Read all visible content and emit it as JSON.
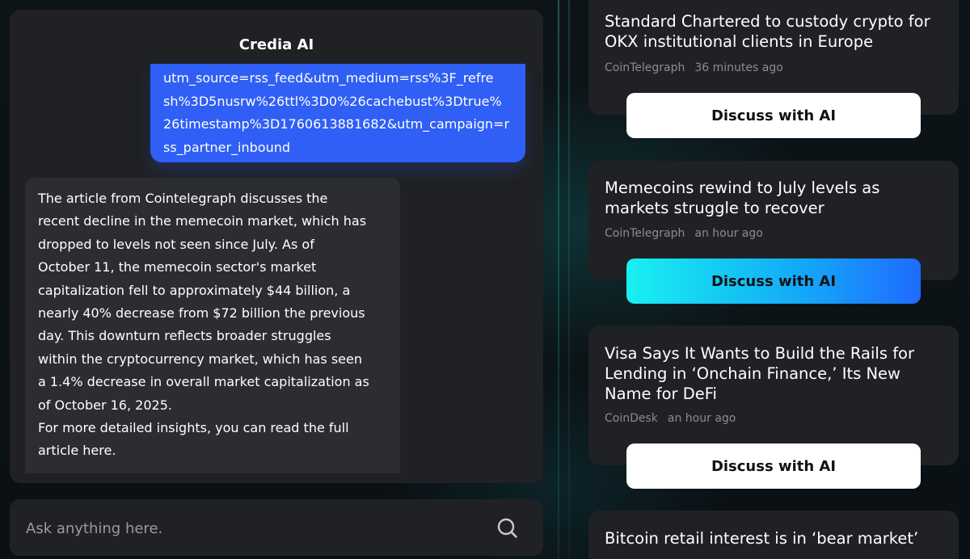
{
  "chat": {
    "title": "Credia AI",
    "user_message_lines": [
      "utm_source=rss_feed&utm_medium=rss%3F_refre",
      "sh%3D5nusrw%26ttl%3D0%26cachebust%3Dtrue%",
      "26timestamp%3D1760613881682&utm_campaign=r",
      "ss_partner_inbound"
    ],
    "ai_message_lines": [
      "The article from Cointelegraph discusses the",
      "recent decline in the memecoin market, which has",
      "dropped to levels not seen since July. As of",
      "October 11, the memecoin sector's market",
      "capitalization fell to approximately $44 billion, a",
      "nearly 40% decrease from $72 billion the previous",
      "day. This downturn reflects broader struggles",
      "within the cryptocurrency market, which has seen",
      "a 1.4% decrease in overall market capitalization as",
      "of October 16, 2025.",
      "For more detailed insights, you can read the full",
      "article here."
    ],
    "input_placeholder": "Ask anything here.",
    "search_icon": "search-icon"
  },
  "news": [
    {
      "title_lines": [
        "Standard Chartered to custody crypto for",
        "OKX institutional clients in Europe"
      ],
      "source": "CoinTelegraph",
      "time": "36 minutes ago",
      "button_label": "Discuss with AI",
      "active": false
    },
    {
      "title_lines": [
        "Memecoins rewind to July levels as",
        "markets struggle to recover"
      ],
      "source": "CoinTelegraph",
      "time": "an hour ago",
      "button_label": "Discuss with AI",
      "active": true
    },
    {
      "title_lines": [
        "Visa Says It Wants to Build the Rails for",
        "Lending in ‘Onchain Finance,’ Its New",
        "Name for DeFi"
      ],
      "source": "CoinDesk",
      "time": "an hour ago",
      "button_label": "Discuss with AI",
      "active": false
    },
    {
      "title_lines": [
        "Bitcoin retail interest is in ‘bear market’"
      ],
      "source": "",
      "time": "",
      "button_label": "",
      "active": false
    }
  ],
  "colors": {
    "panel": "#202124",
    "user_bubble": "#2f5ff5",
    "ai_bubble": "#2c2d31",
    "accent_gradient_start": "#19f0f0",
    "accent_gradient_end": "#1f6bff"
  }
}
